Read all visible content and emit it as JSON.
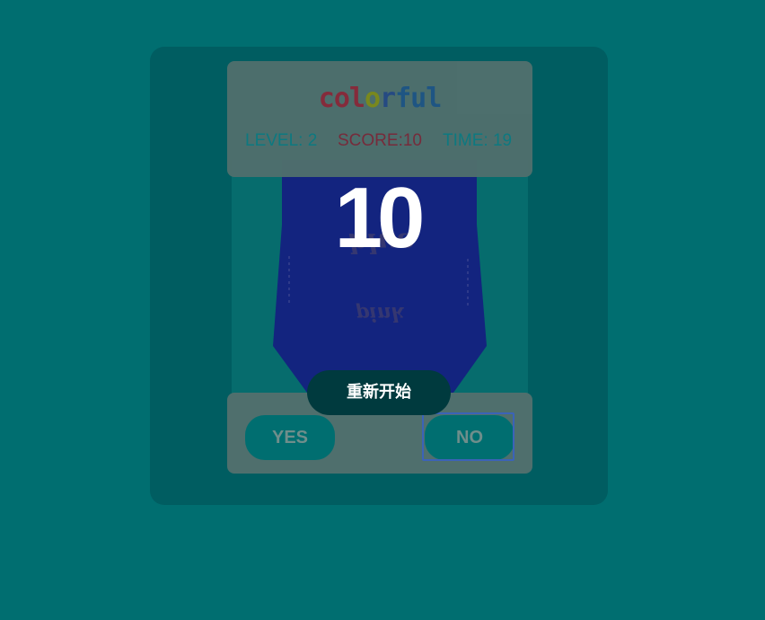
{
  "game": {
    "logo_letters": [
      "c",
      "o",
      "l",
      "o",
      "r",
      "f",
      "u",
      "l"
    ],
    "level_text": "LEVEL: 2",
    "score_text": "SCORE:10",
    "time_text": "TIME: 19",
    "countdown": "10",
    "card_words": [
      "blue",
      "pink"
    ],
    "card_color": "#13247f"
  },
  "buttons": {
    "yes_label": "YES",
    "no_label": "NO",
    "restart_label": "重新开始"
  },
  "colors": {
    "background": "#006e70",
    "overlay_panel": "#005d61",
    "focus_ring": "#3b63b8"
  }
}
